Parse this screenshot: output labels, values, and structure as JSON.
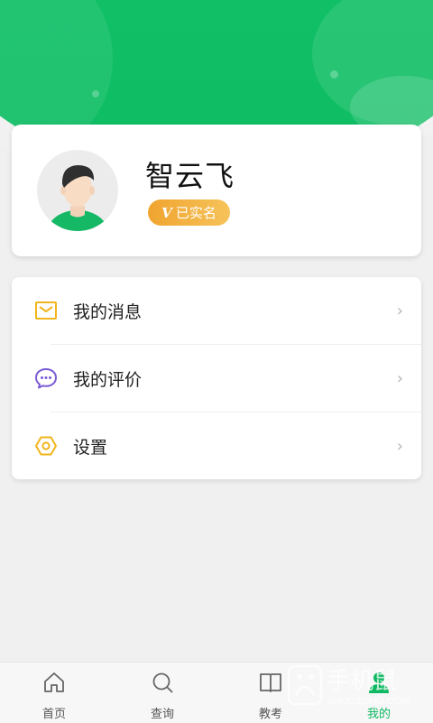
{
  "profile": {
    "name": "智云飞",
    "badge_mark": "V",
    "badge_text": "已实名"
  },
  "menu": {
    "items": [
      {
        "label": "我的消息",
        "icon": "envelope-icon"
      },
      {
        "label": "我的评价",
        "icon": "chat-bubble-icon"
      },
      {
        "label": "设置",
        "icon": "hexagon-settings-icon"
      }
    ],
    "chevron": "›"
  },
  "tabbar": {
    "tabs": [
      {
        "label": "首页",
        "icon": "home-icon",
        "active": false
      },
      {
        "label": "查询",
        "icon": "search-icon",
        "active": false
      },
      {
        "label": "教考",
        "icon": "book-icon",
        "active": false
      },
      {
        "label": "我的",
        "icon": "user-icon",
        "active": true
      }
    ]
  },
  "watermark": {
    "title": "手机鼠",
    "subtitle": "SHOUJISHU.COM"
  },
  "colors": {
    "brand_green": "#0fb862",
    "badge_orange": "#f0a42f",
    "envelope_yellow": "#f2b51b",
    "chat_purple": "#7b5cd6"
  }
}
